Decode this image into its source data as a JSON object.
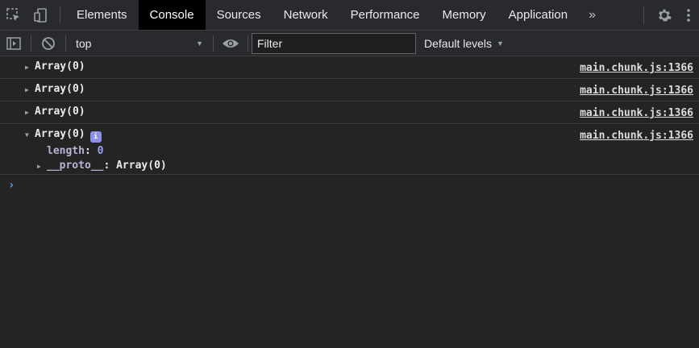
{
  "tabs": [
    {
      "label": "Elements"
    },
    {
      "label": "Console"
    },
    {
      "label": "Sources"
    },
    {
      "label": "Network"
    },
    {
      "label": "Performance"
    },
    {
      "label": "Memory"
    },
    {
      "label": "Application"
    }
  ],
  "more_tabs": "»",
  "toolbar": {
    "context": "top",
    "filter_placeholder": "Filter",
    "levels": "Default levels"
  },
  "messages": [
    {
      "text": "Array(0)",
      "source": "main.chunk.js:1366"
    },
    {
      "text": "Array(0)",
      "source": "main.chunk.js:1366"
    },
    {
      "text": "Array(0)",
      "source": "main.chunk.js:1366"
    },
    {
      "text": "Array(0)",
      "source": "main.chunk.js:1366",
      "expanded": {
        "length_key": "length",
        "length_value": "0",
        "proto_key": "__proto__",
        "proto_value": "Array(0)"
      }
    }
  ],
  "prompt": "›",
  "colors": {
    "background": "#242424",
    "toolbar": "#292a2d",
    "active_tab": "#000000",
    "prompt": "#5fa3f5",
    "badge": "#8b8fe8"
  }
}
